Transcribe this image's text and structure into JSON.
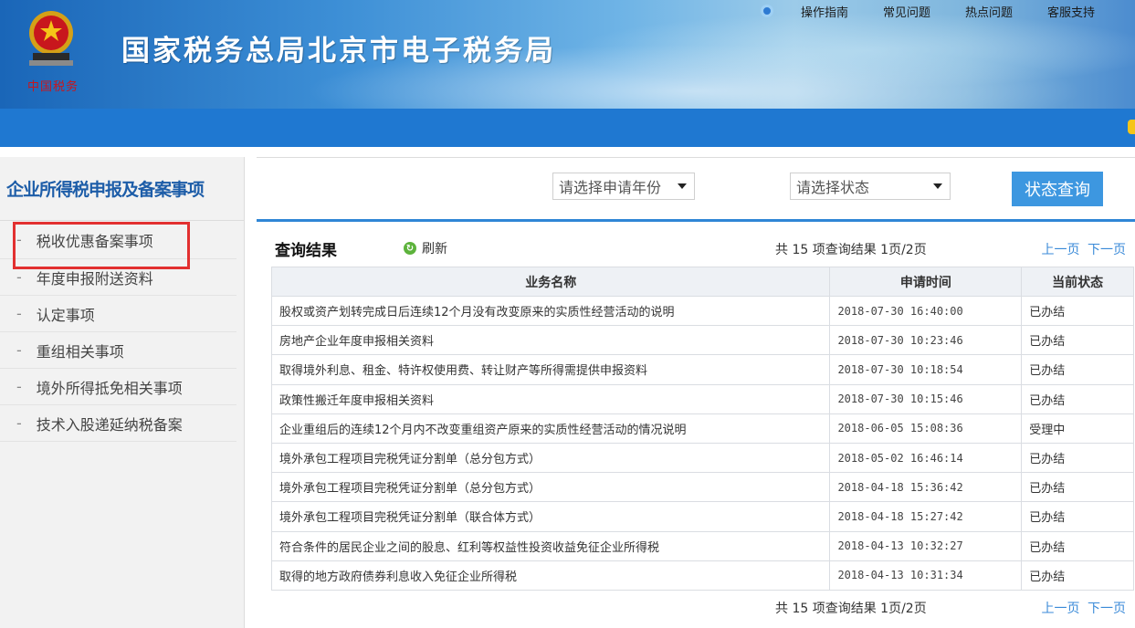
{
  "header": {
    "site_title": "国家税务总局北京市电子税务局",
    "emblem_text": "中国税务",
    "topnav": [
      "操作指南",
      "常见问题",
      "热点问题",
      "客服支持"
    ]
  },
  "sidebar": {
    "title": "企业所得税申报及备案事项",
    "items": [
      {
        "label": "税收优惠备案事项"
      },
      {
        "label": "年度申报附送资料"
      },
      {
        "label": "认定事项"
      },
      {
        "label": "重组相关事项"
      },
      {
        "label": "境外所得抵免相关事项"
      },
      {
        "label": "技术入股递延纳税备案"
      }
    ],
    "dash": "-"
  },
  "filters": {
    "year_placeholder": "请选择申请年份",
    "status_placeholder": "请选择状态",
    "query_button": "状态查询"
  },
  "results": {
    "title": "查询结果",
    "refresh": "刷新",
    "count_text": "共 15 项查询结果 1页/2页",
    "prev": "上一页",
    "next": "下一页",
    "columns": [
      "业务名称",
      "申请时间",
      "当前状态"
    ],
    "rows": [
      [
        "股权或资产划转完成日后连续12个月没有改变原来的实质性经营活动的说明",
        "2018-07-30 16:40:00",
        "已办结"
      ],
      [
        "房地产企业年度申报相关资料",
        "2018-07-30 10:23:46",
        "已办结"
      ],
      [
        "取得境外利息、租金、特许权使用费、转让财产等所得需提供申报资料",
        "2018-07-30 10:18:54",
        "已办结"
      ],
      [
        "政策性搬迁年度申报相关资料",
        "2018-07-30 10:15:46",
        "已办结"
      ],
      [
        "企业重组后的连续12个月内不改变重组资产原来的实质性经营活动的情况说明",
        "2018-06-05 15:08:36",
        "受理中"
      ],
      [
        "境外承包工程项目完税凭证分割单（总分包方式）",
        "2018-05-02 16:46:14",
        "已办结"
      ],
      [
        "境外承包工程项目完税凭证分割单（总分包方式）",
        "2018-04-18 15:36:42",
        "已办结"
      ],
      [
        "境外承包工程项目完税凭证分割单（联合体方式）",
        "2018-04-18 15:27:42",
        "已办结"
      ],
      [
        "符合条件的居民企业之间的股息、红利等权益性投资收益免征企业所得税",
        "2018-04-13 10:32:27",
        "已办结"
      ],
      [
        "取得的地方政府债券利息收入免征企业所得税",
        "2018-04-13 10:31:34",
        "已办结"
      ]
    ]
  },
  "colors": {
    "brand_blue": "#1f78d1",
    "highlight_red": "#e23030",
    "link_blue": "#3a8ad8"
  }
}
